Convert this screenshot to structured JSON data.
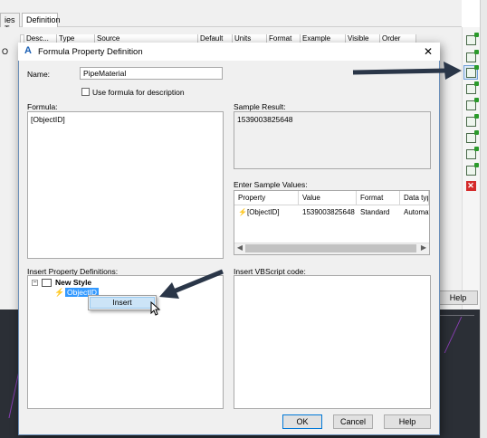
{
  "background": {
    "tabs": [
      "ies To",
      "Definition"
    ],
    "columns": [
      "Desc...",
      "Type",
      "Source",
      "Default",
      "Units",
      "Format",
      "Example",
      "Visible",
      "Order"
    ],
    "left_fragment": "O",
    "help_label": "Help"
  },
  "toolbar": {
    "icons": [
      "add-property-icon",
      "add-automatic-property-icon",
      "add-formula-property-icon",
      "add-location-property-icon",
      "add-classification-property-icon",
      "add-material-property-icon",
      "add-graphic-property-icon",
      "add-anchor-property-icon",
      "add-refdef-property-icon",
      "delete-property-icon"
    ]
  },
  "dialog": {
    "title": "Formula Property Definition",
    "name_label": "Name:",
    "name_value": "PipeMaterial",
    "use_formula_label": "Use formula for description",
    "formula_label": "Formula:",
    "formula_value": "[ObjectID]",
    "sample_result_label": "Sample Result:",
    "sample_result_value": "1539003825648",
    "sample_values_label": "Enter Sample Values:",
    "grid": {
      "columns": [
        "Property",
        "Value",
        "Format",
        "Data typ"
      ],
      "rows": [
        {
          "property": "[ObjectID]",
          "value": "1539003825648",
          "format": "Standard",
          "data_type": "Automat"
        }
      ]
    },
    "insert_defs_label": "Insert Property Definitions:",
    "tree": {
      "root": "New Style",
      "child": "ObjectID"
    },
    "context_menu": {
      "insert": "Insert"
    },
    "vbscript_label": "Insert VBScript code:",
    "buttons": {
      "ok": "OK",
      "cancel": "Cancel",
      "help": "Help"
    }
  }
}
